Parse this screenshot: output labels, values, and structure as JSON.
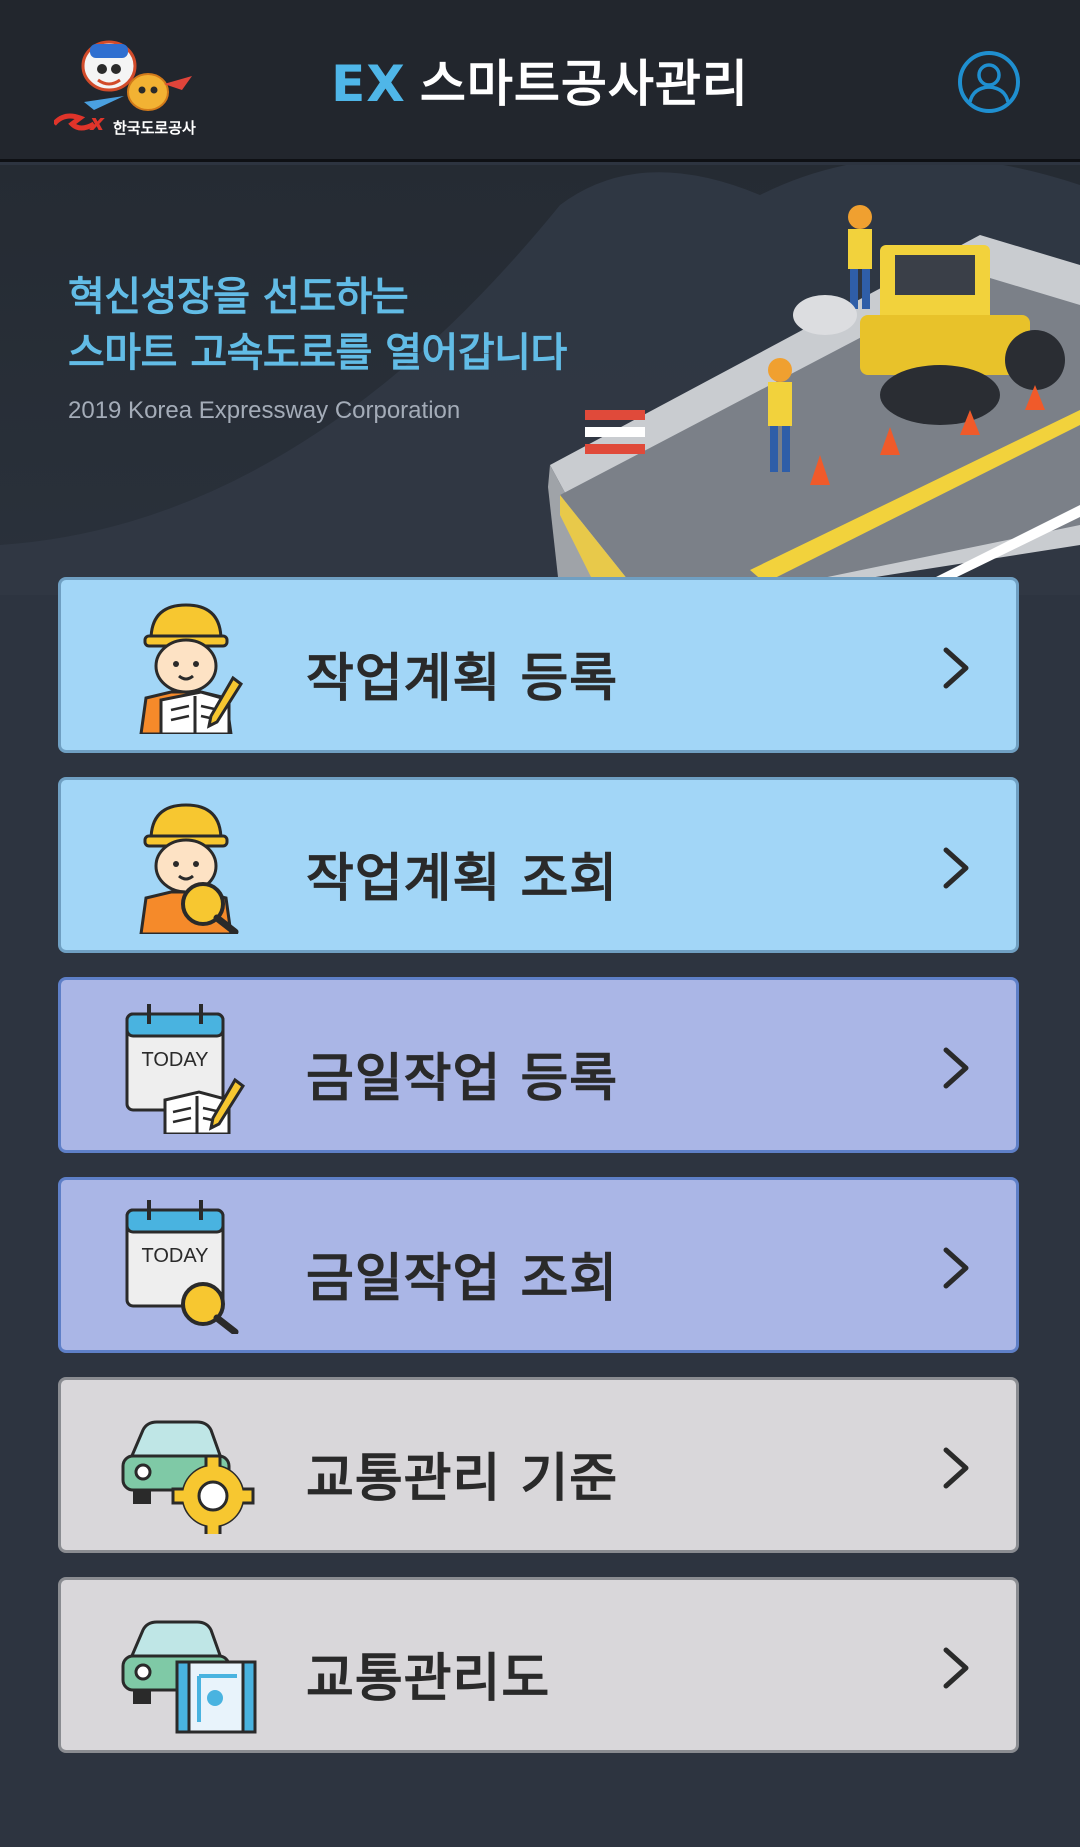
{
  "header": {
    "logo_text": "한국도로공사",
    "title_prefix": "EX",
    "title_main": "스마트공사관리",
    "profile_icon": "user-profile-icon"
  },
  "hero": {
    "line1": "혁신성장을 선도하는",
    "line2": "스마트 고속도로를 열어갑니다",
    "sub": "2019 Korea Expressway Corporation"
  },
  "menu": [
    {
      "label": "작업계획 등록",
      "icon": "worker-book-icon",
      "theme": "blue"
    },
    {
      "label": "작업계획 조회",
      "icon": "worker-search-icon",
      "theme": "blue"
    },
    {
      "label": "금일작업 등록",
      "icon": "today-calendar-book-icon",
      "theme": "purple",
      "icon_text": "TODAY"
    },
    {
      "label": "금일작업 조회",
      "icon": "today-calendar-search-icon",
      "theme": "purple",
      "icon_text": "TODAY"
    },
    {
      "label": "교통관리 기준",
      "icon": "car-gear-icon",
      "theme": "gray"
    },
    {
      "label": "교통관리도",
      "icon": "car-map-icon",
      "theme": "gray"
    }
  ],
  "colors": {
    "accent": "#4fb6e8",
    "blue_button": "#a2d6f7",
    "purple_button": "#aab6e6",
    "gray_button": "#d9d7da",
    "background": "#2d3440"
  }
}
